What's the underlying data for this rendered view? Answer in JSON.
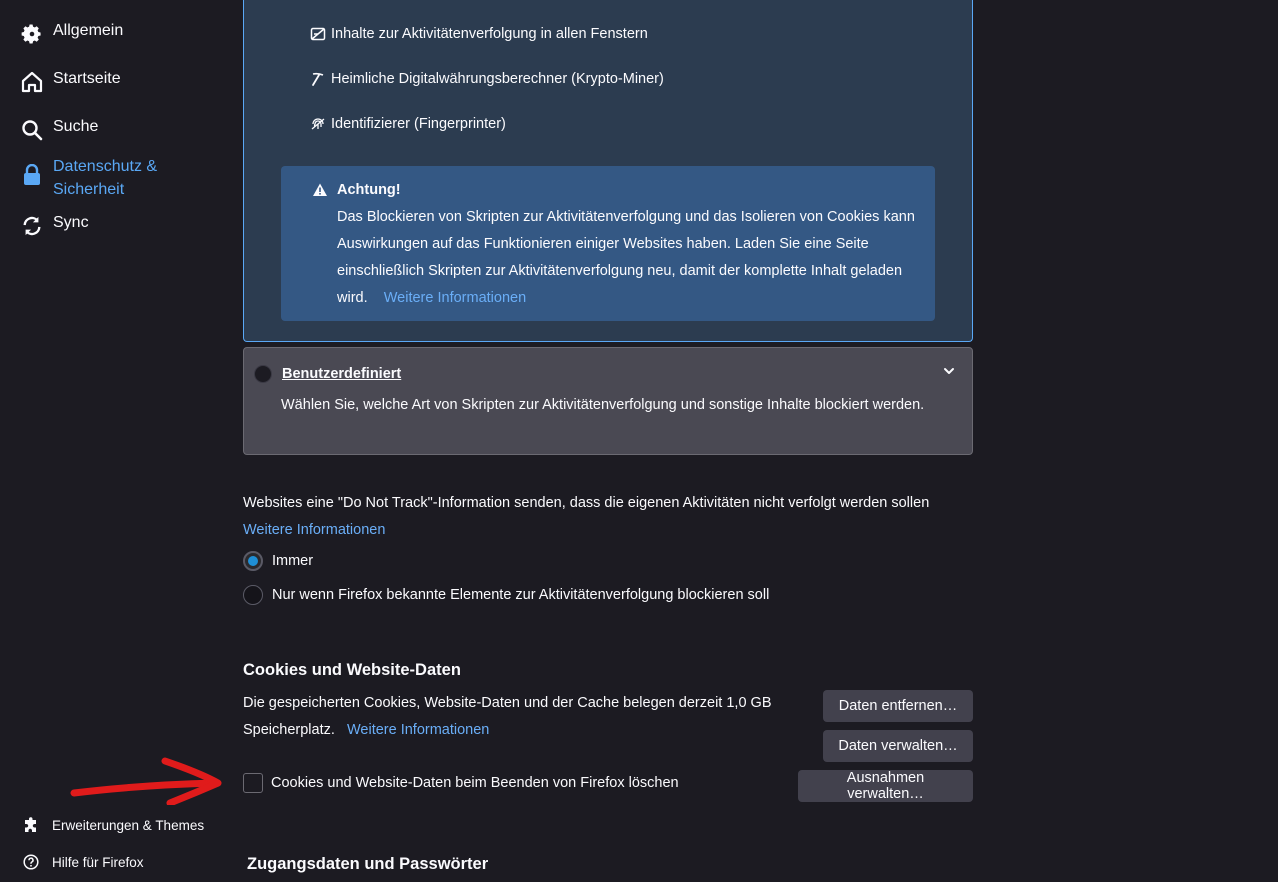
{
  "sidebar": {
    "items": [
      {
        "label": "Allgemein",
        "icon": "gear-icon"
      },
      {
        "label": "Startseite",
        "icon": "home-icon"
      },
      {
        "label": "Suche",
        "icon": "search-icon"
      },
      {
        "label": "Datenschutz &",
        "label2": "Sicherheit",
        "icon": "lock-icon",
        "active": true
      },
      {
        "label": "Sync",
        "icon": "sync-icon"
      }
    ],
    "footer": [
      {
        "label": "Erweiterungen & Themes",
        "icon": "puzzle-icon"
      },
      {
        "label": "Hilfe für Firefox",
        "icon": "help-icon"
      }
    ]
  },
  "strict": {
    "items": [
      "Inhalte zur Aktivitätenverfolgung in allen Fenstern",
      "Heimliche Digitalwährungsberechner (Krypto-Miner)",
      "Identifizierer (Fingerprinter)"
    ],
    "warning": {
      "title": "Achtung!",
      "text": "Das Blockieren von Skripten zur Aktivitätenverfolgung und das Isolieren von Cookies kann Auswirkungen auf das Funktionieren einiger Websites haben. Laden Sie eine Seite einschließlich Skripten zur Aktivitätenverfolgung neu, damit der komplette Inhalt geladen wird.",
      "link": "Weitere Informationen"
    }
  },
  "custom": {
    "title": "Benutzerdefiniert",
    "description": "Wählen Sie, welche Art von Skripten zur Aktivitätenverfolgung und sonstige Inhalte blockiert werden."
  },
  "dnt": {
    "text": "Websites eine \"Do Not Track\"-Information senden, dass die eigenen Aktivitäten nicht verfolgt werden sollen",
    "link": "Weitere Informationen",
    "options": [
      {
        "label": "Immer",
        "checked": true
      },
      {
        "label": "Nur wenn Firefox bekannte Elemente zur Aktivitätenverfolgung blockieren soll",
        "checked": false
      }
    ]
  },
  "cookies": {
    "title": "Cookies und Website-Daten",
    "text": "Die gespeicherten Cookies, Website-Daten und der Cache belegen derzeit 1,0 GB Speicherplatz.",
    "link": "Weitere Informationen",
    "buttons": {
      "remove": "Daten entfernen…",
      "manage": "Daten verwalten…",
      "exceptions": "Ausnahmen verwalten…"
    },
    "checkbox_label": "Cookies und Website-Daten beim Beenden von Firefox löschen",
    "checkbox_checked": false
  },
  "logins": {
    "title": "Zugangsdaten und Passwörter"
  },
  "colors": {
    "background": "#1c1b22",
    "accent": "#5aa8f5",
    "warning_bg": "#345884",
    "annotation_arrow": "#e01b1b"
  }
}
